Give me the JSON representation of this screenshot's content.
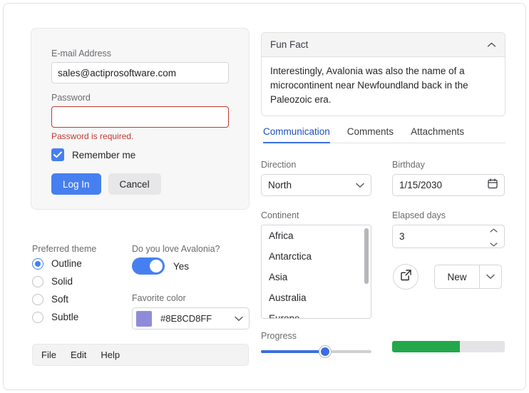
{
  "login": {
    "email_label": "E-mail Address",
    "email_value": "sales@actiprosoftware.com",
    "email_placeholder": "E-mail Address",
    "password_label": "Password",
    "password_value": "",
    "password_placeholder": "",
    "password_error": "Password is required.",
    "remember_label": "Remember me",
    "remember_checked": true,
    "login_button": "Log In",
    "cancel_button": "Cancel"
  },
  "theme": {
    "label": "Preferred theme",
    "options": [
      "Outline",
      "Solid",
      "Soft",
      "Subtle"
    ],
    "selected": "Outline"
  },
  "love": {
    "label": "Do you love Avalonia?",
    "state_text": "Yes",
    "on": true,
    "accent": "#4680f0"
  },
  "favorite_color": {
    "label": "Favorite color",
    "value": "#8E8CD8FF",
    "swatch": "#8E8CD8"
  },
  "menubar": {
    "items": [
      "File",
      "Edit",
      "Help"
    ]
  },
  "fun_fact": {
    "title": "Fun Fact",
    "body": "Interestingly, Avalonia was also the name of a microcontinent near Newfoundland back in the Paleozoic era.",
    "expanded": true,
    "chevron": "chevron-up-icon"
  },
  "tabs": {
    "items": [
      "Communication",
      "Comments",
      "Attachments"
    ],
    "active": "Communication"
  },
  "direction": {
    "label": "Direction",
    "value": "North"
  },
  "birthday": {
    "label": "Birthday",
    "value": "1/15/2030",
    "icon": "calendar-icon"
  },
  "continent": {
    "label": "Continent",
    "items": [
      "Africa",
      "Antarctica",
      "Asia",
      "Australia",
      "Europe"
    ]
  },
  "elapsed_days": {
    "label": "Elapsed days",
    "value": "3"
  },
  "actions": {
    "open_icon": "external-link-icon",
    "split_label": "New",
    "split_chevron": "chevron-down-icon"
  },
  "progress": {
    "label": "Progress",
    "slider_percent": 58,
    "bar_percent": 60,
    "bar_color": "#22a84b",
    "slider_color": "#3a6fe0"
  }
}
